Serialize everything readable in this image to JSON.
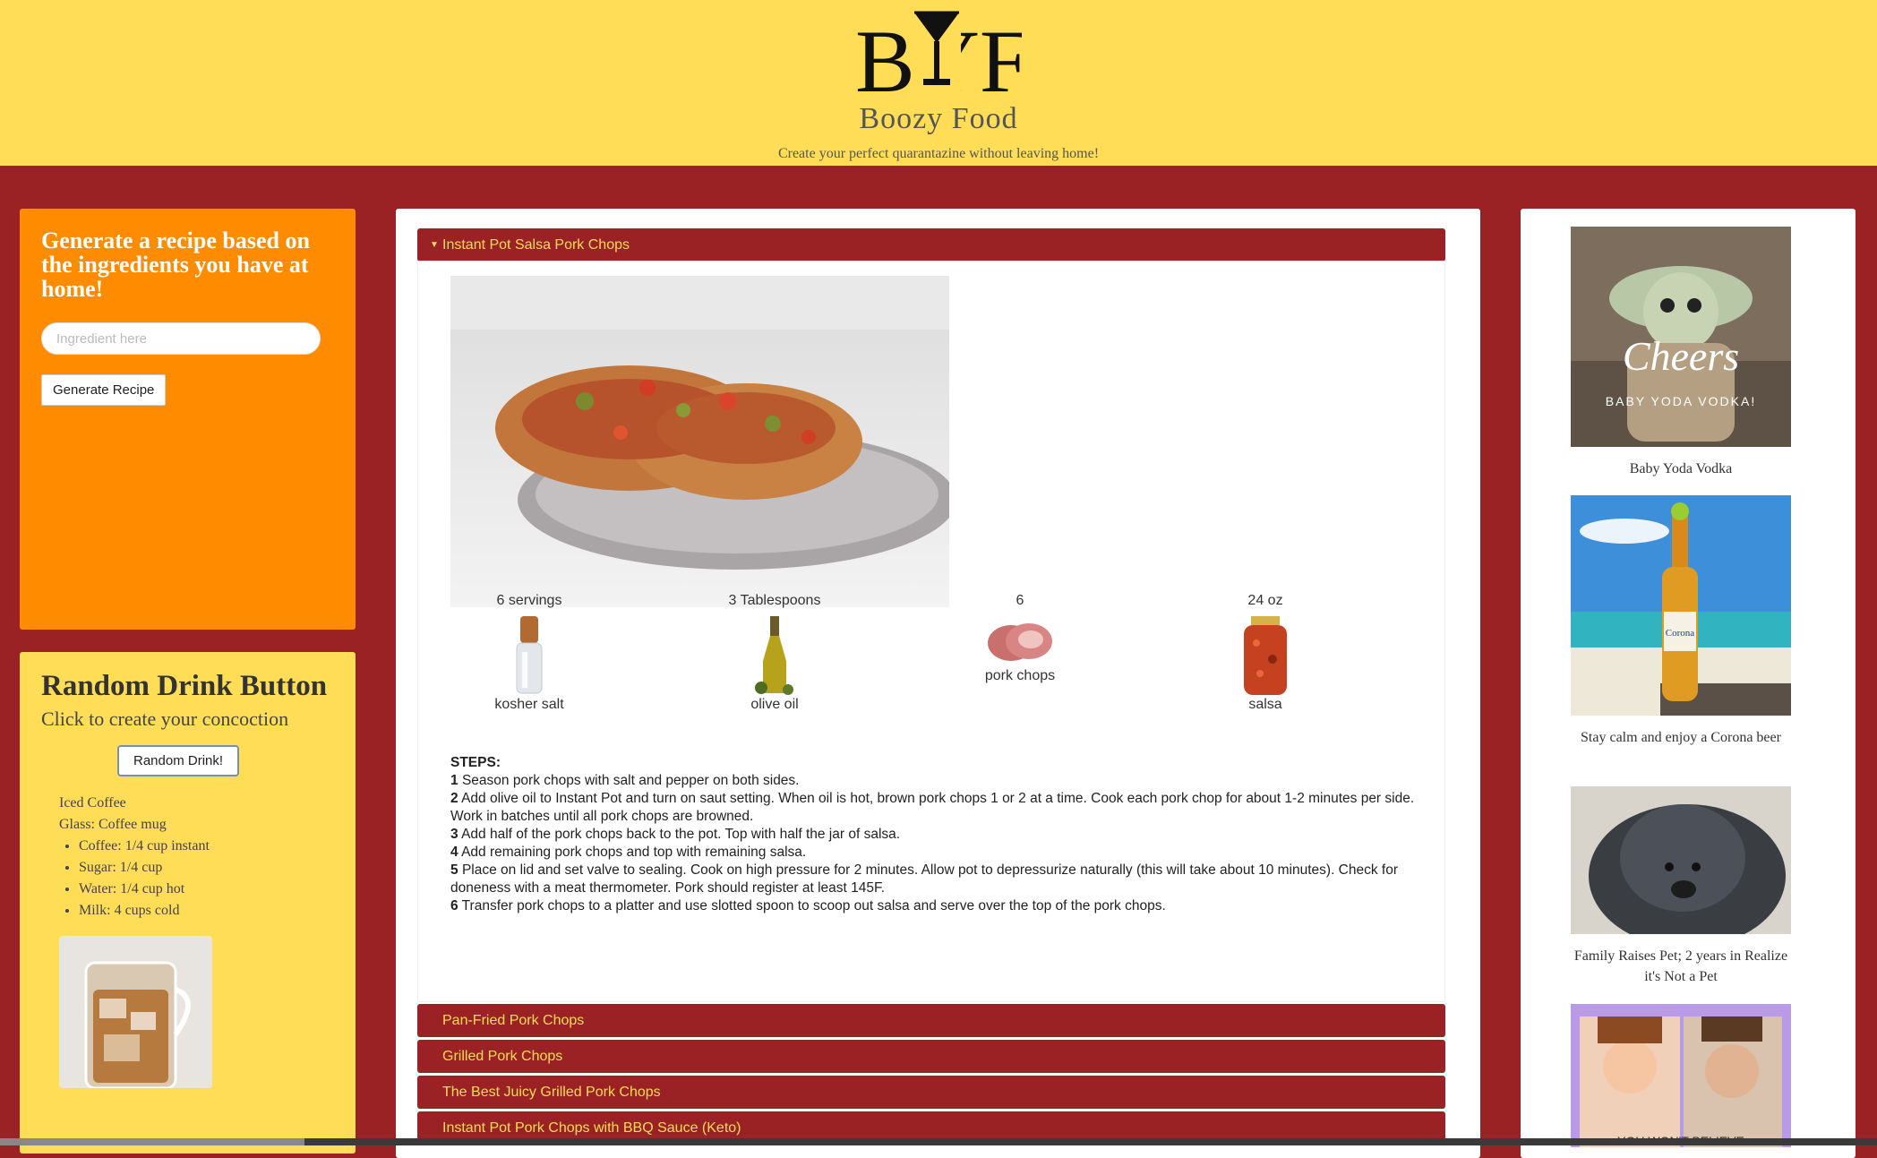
{
  "header": {
    "logo_text": "BYF",
    "brand": "Boozy Food",
    "tagline": "Create your perfect quarantazine without leaving home!"
  },
  "generator": {
    "title": "Generate a recipe based on the ingredients you have at home!",
    "input_placeholder": "Ingredient here",
    "input_value": "",
    "button_label": "Generate Recipe"
  },
  "random_drink": {
    "title": "Random Drink Button",
    "subtitle": "Click to create your concoction",
    "button_label": "Random Drink!",
    "drink_name": "Iced Coffee",
    "glass": "Glass: Coffee mug",
    "ingredients": [
      "Coffee: 1/4 cup instant",
      "Sugar: 1/4 cup",
      "Water: 1/4 cup hot",
      "Milk: 4 cups cold"
    ]
  },
  "recipes": {
    "open": {
      "title": "Instant Pot Salsa Pork Chops",
      "ingredients": [
        {
          "amount": "6 servings",
          "name": "kosher salt",
          "icon": "salt-shaker-icon"
        },
        {
          "amount": "3 Tablespoons",
          "name": "olive oil",
          "icon": "olive-oil-bottle-icon"
        },
        {
          "amount": "6",
          "name": "pork chops",
          "icon": "pork-chops-icon"
        },
        {
          "amount": "24 oz",
          "name": "salsa",
          "icon": "salsa-jar-icon"
        }
      ],
      "steps_label": "STEPS:",
      "steps": [
        {
          "n": "1",
          "text": "Season pork chops with salt and pepper on both sides."
        },
        {
          "n": "2",
          "text": "Add olive oil to Instant Pot and turn on saut setting. When oil is hot, brown pork chops 1 or 2 at a time. Cook each pork chop for about 1-2 minutes per side. Work in batches until all pork chops are browned."
        },
        {
          "n": "3",
          "text": "Add half of the pork chops back to the pot. Top with half the jar of salsa."
        },
        {
          "n": "4",
          "text": "Add remaining pork chops and top with remaining salsa."
        },
        {
          "n": "5",
          "text": "Place on lid and set valve to sealing. Cook on high pressure for 2 minutes. Allow pot to depressurize naturally (this will take about 10 minutes). Check for doneness with a meat thermometer. Pork should register at least 145F."
        },
        {
          "n": "6",
          "text": "Transfer pork chops to a platter and use slotted spoon to scoop out salsa and serve over the top of the pork chops."
        }
      ]
    },
    "collapsed": [
      "Pan-Fried Pork Chops",
      "Grilled Pork Chops",
      "The Best Juicy Grilled Pork Chops",
      "Instant Pot Pork Chops with BBQ Sauce (Keto)"
    ]
  },
  "ads": [
    {
      "caption": "Baby Yoda Vodka",
      "image_text": "Cheers",
      "image_subtext": "BABY YODA VODKA!"
    },
    {
      "caption": "Stay calm and enjoy a Corona beer",
      "image_text": "Corona"
    },
    {
      "caption": "Family Raises Pet; 2 years in Realize it's Not a Pet"
    },
    {
      "caption": "",
      "image_text": "YOU WON'T BELIEVE"
    }
  ],
  "colors": {
    "page_bg": "#9a2124",
    "header_bg": "#ffdd57",
    "orange_panel": "#ff8c00",
    "accordion_text": "#ffdd57"
  }
}
